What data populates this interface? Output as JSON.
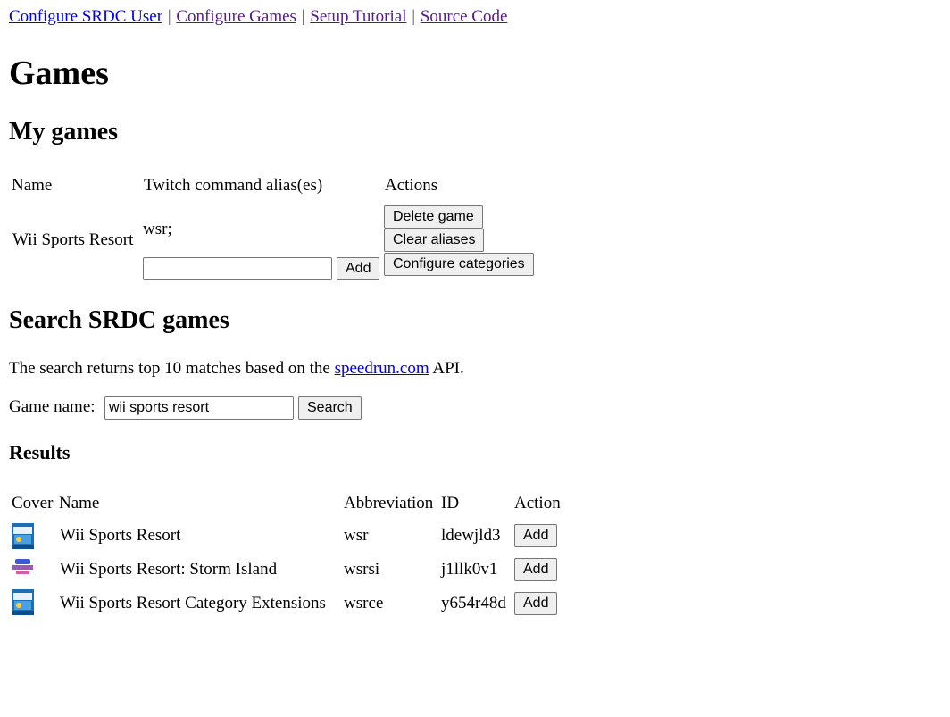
{
  "nav": {
    "links": [
      {
        "label": "Configure SRDC User"
      },
      {
        "label": "Configure Games"
      },
      {
        "label": "Setup Tutorial"
      },
      {
        "label": "Source Code"
      }
    ],
    "separator": "|"
  },
  "page_title": "Games",
  "my_games": {
    "heading": "My games",
    "columns": [
      "Name",
      "Twitch command alias(es)",
      "Actions"
    ],
    "rows": [
      {
        "name": "Wii Sports Resort",
        "aliases": "wsr;",
        "alias_input_value": "",
        "add_label": "Add",
        "actions": [
          "Delete game",
          "Clear aliases",
          "Configure categories"
        ]
      }
    ]
  },
  "search": {
    "heading": "Search SRDC games",
    "description_before": "The search returns top 10 matches based on the ",
    "description_link": "speedrun.com",
    "description_after": " API.",
    "label": "Game name:",
    "input_value": "wii sports resort",
    "button_label": "Search"
  },
  "results": {
    "heading": "Results",
    "columns": [
      "Cover",
      "Name",
      "Abbreviation",
      "ID",
      "Action"
    ],
    "rows": [
      {
        "cover": "wii-sports-resort-cover",
        "name": "Wii Sports Resort",
        "abbreviation": "wsr",
        "id": "ldewjld3",
        "action": "Add"
      },
      {
        "cover": "storm-island-cover",
        "name": "Wii Sports Resort: Storm Island",
        "abbreviation": "wsrsi",
        "id": "j1llk0v1",
        "action": "Add"
      },
      {
        "cover": "category-extensions-cover",
        "name": "Wii Sports Resort Category Extensions",
        "abbreviation": "wsrce",
        "id": "y654r48d",
        "action": "Add"
      }
    ]
  },
  "colors": {
    "link": "#0000ee",
    "visited_link": "#551a8b",
    "button_bg": "#efefef"
  }
}
